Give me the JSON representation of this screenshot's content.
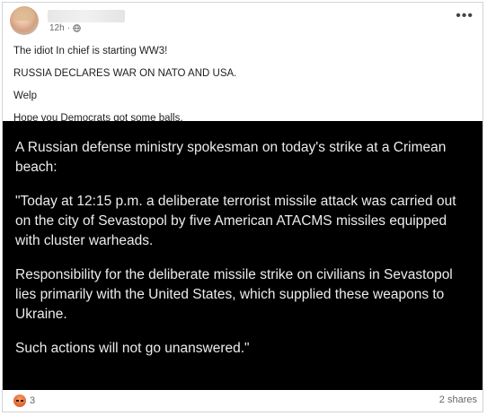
{
  "post": {
    "time": "12h",
    "privacy_icon": "globe-icon",
    "more_label": "•••",
    "caption_lines": [
      "The idiot In chief is starting WW3!",
      "RUSSIA DECLARES WAR ON NATO AND USA.",
      "Welp",
      "Hope you Democrats got some balls."
    ],
    "image_paragraphs": [
      "A Russian defense ministry spokesman on today's strike at a Crimean beach:",
      "\"Today at 12:15 p.m. a deliberate terrorist missile attack was carried out on the city of Sevastopol by five American ATACMS missiles equipped with cluster warheads.",
      "Responsibility for the deliberate missile strike on civilians in Sevastopol lies primarily with the United States, which supplied these weapons to Ukraine.",
      "Such actions will not go unanswered.\""
    ]
  },
  "footer": {
    "reaction_icon": "angry-reaction-icon",
    "reaction_count": "3",
    "shares": "2 shares"
  },
  "colors": {
    "image_background": "#000000",
    "image_text": "#ececec",
    "meta_text": "#65676b",
    "reaction_angry": "#e36b3a"
  }
}
